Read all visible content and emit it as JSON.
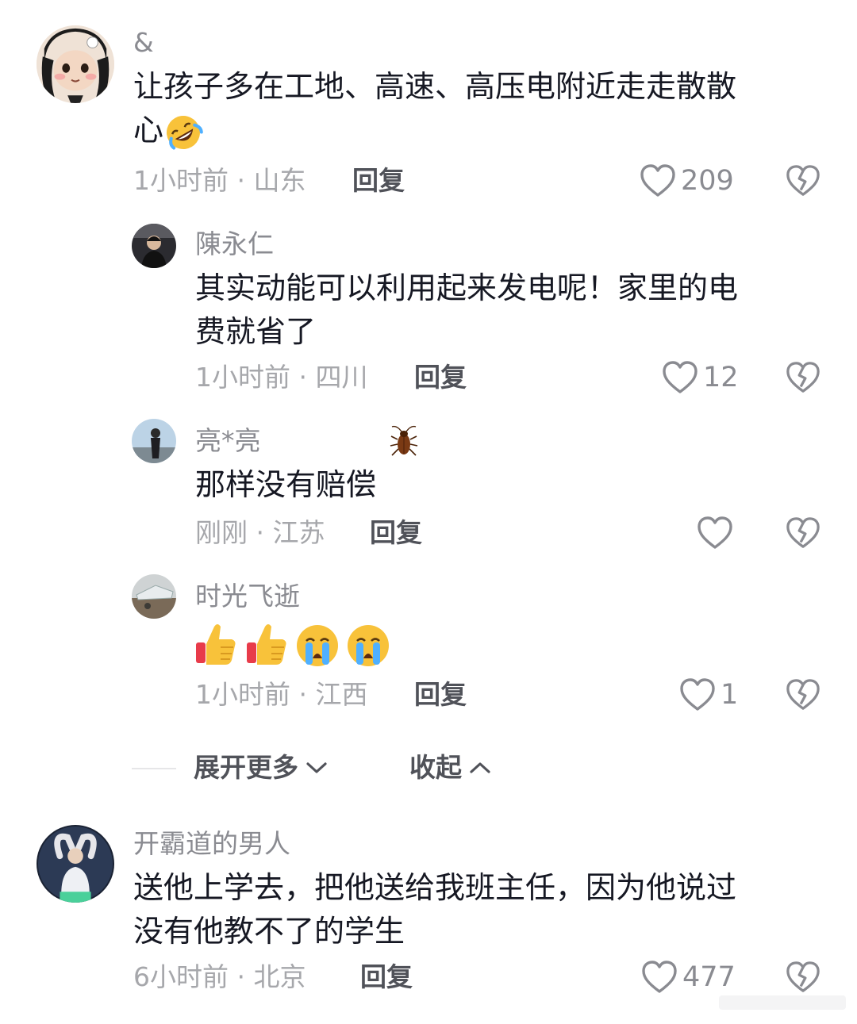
{
  "comments": [
    {
      "username": "&",
      "text": "让孩子多在工地、高速、高压电附近走走散散心",
      "text_line1": "让孩子多在工地、高速、高压电附近走走散散",
      "text_line2": "心",
      "emoji": "rolling-on-floor-laughing",
      "time_location": "1小时前 · 山东",
      "reply_label": "回复",
      "likes": "209"
    },
    {
      "username": "陳永仁",
      "text_line1": "其实动能可以利用起来发电呢！家里的电",
      "text_line2": "费就省了",
      "time_location": "1小时前 · 四川",
      "reply_label": "回复",
      "likes": "12"
    },
    {
      "username": "亮*亮",
      "badge_icon": "cockroach",
      "text_line1": "那样没有赔偿",
      "time_location": "刚刚 · 江苏",
      "reply_label": "回复",
      "likes": ""
    },
    {
      "username": "时光飞逝",
      "emojis": [
        "thumbs-up",
        "thumbs-up",
        "loudly-crying-face",
        "loudly-crying-face"
      ],
      "time_location": "1小时前 · 江西",
      "reply_label": "回复",
      "likes": "1"
    },
    {
      "username": "开霸道的男人",
      "text_line1": "送他上学去，把他送给我班主任，因为他说过",
      "text_line2": "没有他教不了的学生",
      "time_location": "6小时前 · 北京",
      "reply_label": "回复",
      "likes": "477"
    }
  ],
  "controls": {
    "expand_more": "展开更多",
    "collapse": "收起"
  },
  "colors": {
    "text_primary": "#161823",
    "text_secondary": "#8a8b91",
    "text_meta": "#a6a7ab",
    "icon": "#8a8b91"
  }
}
